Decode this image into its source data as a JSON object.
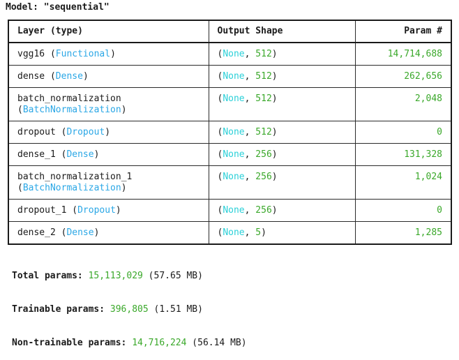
{
  "model": {
    "title_prefix": "Model: ",
    "name_quoted": "\"sequential\""
  },
  "columns": {
    "layer": "Layer (type)",
    "shape": "Output Shape",
    "params": "Param #"
  },
  "rows": [
    {
      "name": "vgg16",
      "type": "Functional",
      "batch": "None",
      "dim": "512",
      "params": "14,714,688",
      "wrap": false
    },
    {
      "name": "dense",
      "type": "Dense",
      "batch": "None",
      "dim": "512",
      "params": "262,656",
      "wrap": false
    },
    {
      "name": "batch_normalization",
      "type": "BatchNormalization",
      "batch": "None",
      "dim": "512",
      "params": "2,048",
      "wrap": true
    },
    {
      "name": "dropout",
      "type": "Dropout",
      "batch": "None",
      "dim": "512",
      "params": "0",
      "wrap": false
    },
    {
      "name": "dense_1",
      "type": "Dense",
      "batch": "None",
      "dim": "256",
      "params": "131,328",
      "wrap": false
    },
    {
      "name": "batch_normalization_1",
      "type": "BatchNormalization",
      "batch": "None",
      "dim": "256",
      "params": "1,024",
      "wrap": true
    },
    {
      "name": "dropout_1",
      "type": "Dropout",
      "batch": "None",
      "dim": "256",
      "params": "0",
      "wrap": false
    },
    {
      "name": "dense_2",
      "type": "Dense",
      "batch": "None",
      "dim": "5",
      "params": "1,285",
      "wrap": false
    }
  ],
  "totals": {
    "total": {
      "label": "Total params: ",
      "value": "15,113,029",
      "size": " (57.65 MB)"
    },
    "trainable": {
      "label": "Trainable params: ",
      "value": "396,805",
      "size": " (1.51 MB)"
    },
    "non_trainable": {
      "label": "Non-trainable params: ",
      "value": "14,716,224",
      "size": " (56.14 MB)"
    }
  },
  "colors": {
    "class_name": "#2aa7e6",
    "none_keyword": "#2ad0d8",
    "number": "#3aa82a"
  }
}
